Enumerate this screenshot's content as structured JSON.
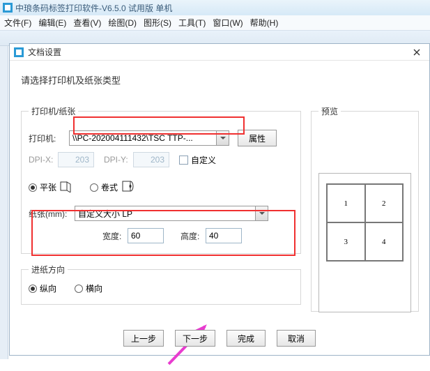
{
  "app": {
    "title": "中琅条码标签打印软件-V6.5.0 试用版 单机",
    "menus": {
      "file": "文件(F)",
      "edit": "编辑(E)",
      "view": "查看(V)",
      "draw": "绘图(D)",
      "shape": "图形(S)",
      "tool": "工具(T)",
      "window": "窗口(W)",
      "help": "帮助(H)"
    }
  },
  "dialog": {
    "title": "文档设置",
    "heading": "请选择打印机及纸张类型",
    "groups": {
      "printer_paper": "打印机/纸张",
      "feed": "进纸方向",
      "preview": "预览"
    },
    "printer_label": "打印机:",
    "printer_value": "\\\\PC-202004111432\\TSC TTP-...",
    "properties_btn": "属性",
    "dpi_x_label": "DPI-X:",
    "dpi_x_value": "203",
    "dpi_y_label": "DPI-Y:",
    "dpi_y_value": "203",
    "custom_dpi_label": "自定义",
    "sheet_label": "平张",
    "roll_label": "卷式",
    "paper_label": "纸张(mm):",
    "paper_value": "自定义大小 LP",
    "width_label": "宽度:",
    "width_value": "60",
    "height_label": "高度:",
    "height_value": "40",
    "portrait_label": "纵向",
    "landscape_label": "横向",
    "preview_cells": [
      "1",
      "2",
      "3",
      "4"
    ],
    "buttons": {
      "prev": "上一步",
      "next": "下一步",
      "finish": "完成",
      "cancel": "取消"
    }
  }
}
